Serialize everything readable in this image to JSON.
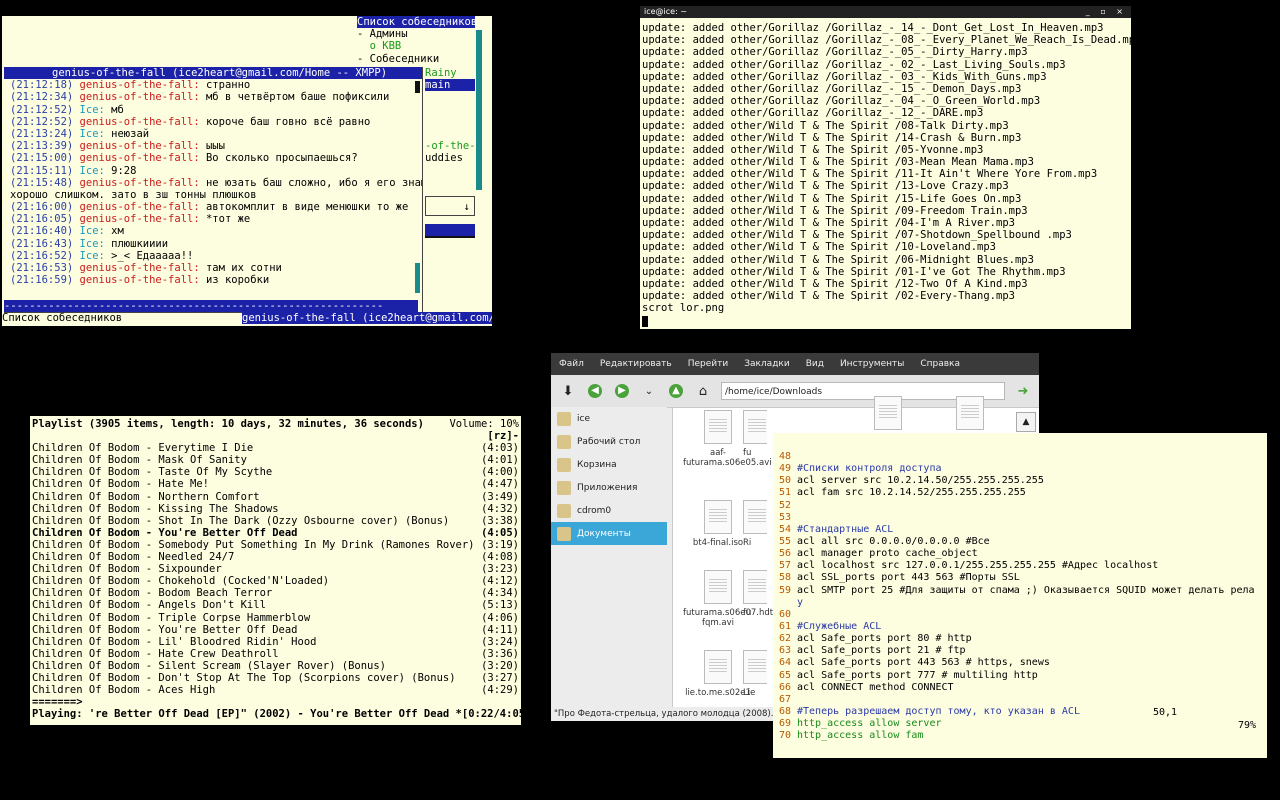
{
  "chat": {
    "roster_title": "Список собеседников",
    "roster_items": [
      "- Админы",
      "  o KBB",
      "- Собеседники"
    ],
    "roster_fragments": {
      "rainy": "Rainy",
      "main": "main",
      "of_the": "-of-the-",
      "buddies": "uddies",
      "arrow": "↓"
    },
    "window_title": "genius-of-the-fall (ice2heart@gmail.com/Home -- XMPP)",
    "messages": [
      {
        "t": "(21:12:18)",
        "n": "genius-of-the-fall:",
        "m": " странно",
        "who": "g"
      },
      {
        "t": "(21:12:34)",
        "n": "genius-of-the-fall:",
        "m": " мб в четвёртом баше пофиксили",
        "who": "g"
      },
      {
        "t": "(21:12:52)",
        "n": "Ice:",
        "m": " мб",
        "who": "i"
      },
      {
        "t": "(21:12:52)",
        "n": "genius-of-the-fall:",
        "m": " короче баш говно всё равно",
        "who": "g"
      },
      {
        "t": "(21:13:24)",
        "n": "Ice:",
        "m": " неюзай",
        "who": "i"
      },
      {
        "t": "(21:13:39)",
        "n": "genius-of-the-fall:",
        "m": " ыыы",
        "who": "g"
      },
      {
        "t": "(21:15:00)",
        "n": "genius-of-the-fall:",
        "m": " Во сколько просыпаешься?",
        "who": "g"
      },
      {
        "t": "(21:15:11)",
        "n": "Ice:",
        "m": " 9:28",
        "who": "i"
      },
      {
        "t": "(21:15:48)",
        "n": "genius-of-the-fall:",
        "m": " не юзать баш сложно, ибо я его знаю",
        "who": "g"
      },
      {
        "t": "",
        "n": "",
        "m": "хорошо слишком. зато в зш тонны плюшков",
        "who": "c"
      },
      {
        "t": "(21:16:00)",
        "n": "genius-of-the-fall:",
        "m": " автокомплит в виде менюшки то же",
        "who": "g"
      },
      {
        "t": "(21:16:05)",
        "n": "genius-of-the-fall:",
        "m": " *тот же",
        "who": "g"
      },
      {
        "t": "(21:16:40)",
        "n": "Ice:",
        "m": " хм",
        "who": "i"
      },
      {
        "t": "(21:16:43)",
        "n": "Ice:",
        "m": " плюшкииии",
        "who": "i"
      },
      {
        "t": "(21:16:52)",
        "n": "Ice:",
        "m": " >_< Едааааа!!",
        "who": "i"
      },
      {
        "t": "(21:16:53)",
        "n": "genius-of-the-fall:",
        "m": " там их сотни",
        "who": "g"
      },
      {
        "t": "(21:16:59)",
        "n": "genius-of-the-fall:",
        "m": " из коробки",
        "who": "g"
      }
    ],
    "separator": "------------------------------------------------------------",
    "status_left": "Список собеседников",
    "status_right": "genius-of-the-fall (ice2heart@gmail.com/"
  },
  "log": {
    "title": "ice@ice: ~",
    "title_buttons": "_ ▫ ×",
    "lines": [
      "update: added other/Gorillaz /Gorillaz_-_14_-_Dont_Get_Lost_In_Heaven.mp3",
      "update: added other/Gorillaz /Gorillaz_-_08_-_Every_Planet_We_Reach_Is_Dead.mp3",
      "update: added other/Gorillaz /Gorillaz_-_05_-_Dirty_Harry.mp3",
      "update: added other/Gorillaz /Gorillaz_-_02_-_Last_Living_Souls.mp3",
      "update: added other/Gorillaz /Gorillaz_-_03_-_Kids_With_Guns.mp3",
      "update: added other/Gorillaz /Gorillaz_-_15_-_Demon_Days.mp3",
      "update: added other/Gorillaz /Gorillaz_-_04_-_O_Green_World.mp3",
      "update: added other/Gorillaz /Gorillaz_-_12_-_DARE.mp3",
      "update: added other/Wild T & The Spirit /08-Talk Dirty.mp3",
      "update: added other/Wild T & The Spirit /14-Crash & Burn.mp3",
      "update: added other/Wild T & The Spirit /05-Yvonne.mp3",
      "update: added other/Wild T & The Spirit /03-Mean Mean Mama.mp3",
      "update: added other/Wild T & The Spirit /11-It Ain't Where Yore From.mp3",
      "update: added other/Wild T & The Spirit /13-Love Crazy.mp3",
      "update: added other/Wild T & The Spirit /15-Life Goes On.mp3",
      "update: added other/Wild T & The Spirit /09-Freedom Train.mp3",
      "update: added other/Wild T & The Spirit /04-I'm A River.mp3",
      "update: added other/Wild T & The Spirit /07-Shotdown_Spellbound .mp3",
      "update: added other/Wild T & The Spirit /10-Loveland.mp3",
      "update: added other/Wild T & The Spirit /06-Midnight Blues.mp3",
      "update: added other/Wild T & The Spirit /01-I've Got The Rhythm.mp3",
      "update: added other/Wild T & The Spirit /12-Two Of A Kind.mp3",
      "update: added other/Wild T & The Spirit /02-Every-Thang.mp3",
      "scrot lor.png"
    ]
  },
  "playlist": {
    "header_left": "Playlist (3905 items, length: 10 days, 32 minutes, 36 seconds)",
    "header_right": "Volume: 10%",
    "mode": "[rz]-",
    "rows": [
      {
        "title": "Children Of Bodom - Everytime I Die",
        "len": "(4:03)"
      },
      {
        "title": "Children Of Bodom - Mask Of Sanity",
        "len": "(4:01)"
      },
      {
        "title": "Children Of Bodom - Taste Of My Scythe",
        "len": "(4:00)"
      },
      {
        "title": "Children Of Bodom - Hate Me!",
        "len": "(4:47)"
      },
      {
        "title": "Children Of Bodom - Northern Comfort",
        "len": "(3:49)"
      },
      {
        "title": "Children Of Bodom - Kissing The Shadows",
        "len": "(4:32)"
      },
      {
        "title": "Children Of Bodom - Shot In The Dark (Ozzy Osbourne cover) (Bonus)",
        "len": "(3:38)"
      },
      {
        "title": "Children Of Bodom - You're Better Off Dead",
        "len": "(4:05)",
        "current": true
      },
      {
        "title": "Children Of Bodom - Somebody Put Something In My Drink (Ramones Rover)",
        "len": "(3:19)"
      },
      {
        "title": "Children Of Bodom - Needled 24/7",
        "len": "(4:08)"
      },
      {
        "title": "Children Of Bodom - Sixpounder",
        "len": "(3:23)"
      },
      {
        "title": "Children Of Bodom - Chokehold (Cocked'N'Loaded)",
        "len": "(4:12)"
      },
      {
        "title": "Children Of Bodom - Bodom Beach Terror",
        "len": "(4:34)"
      },
      {
        "title": "Children Of Bodom - Angels Don't Kill",
        "len": "(5:13)"
      },
      {
        "title": "Children Of Bodom - Triple Corpse Hammerblow",
        "len": "(4:06)"
      },
      {
        "title": "Children Of Bodom - You're Better Off Dead",
        "len": "(4:11)"
      },
      {
        "title": "Children Of Bodom - Lil' Bloodred Ridin' Hood",
        "len": "(3:24)"
      },
      {
        "title": "Children Of Bodom - Hate Crew Deathroll",
        "len": "(3:36)"
      },
      {
        "title": "Children Of Bodom - Silent Scream (Slayer Rover) (Bonus)",
        "len": "(3:20)"
      },
      {
        "title": "Children Of Bodom - Don't Stop At The Top (Scorpions cover) (Bonus)",
        "len": "(3:27)"
      },
      {
        "title": "Children Of Bodom - Aces High",
        "len": "(4:29)"
      }
    ],
    "progress": "=======>",
    "playing": "Playing: 're Better Off Dead [EP]\" (2002) - You're Better Off Dead *",
    "playing_time": "[0:22/4:05]"
  },
  "fm": {
    "menu": [
      "Файл",
      "Редактировать",
      "Перейти",
      "Закладки",
      "Вид",
      "Инструменты",
      "Справка"
    ],
    "path": "/home/ice/Downloads",
    "sidebar": [
      "ice",
      "Рабочий стол",
      "Корзина",
      "Приложения",
      "cdrom0",
      "Документы"
    ],
    "files": [
      {
        "name": "aaf-futurama.s06e05.avi"
      },
      {
        "name": "fu"
      },
      {
        "name": "bt4-final.iso"
      },
      {
        "name": "Ri"
      },
      {
        "name": "futurama.s06e07.hdtv.xvid-fqm.avi"
      },
      {
        "name": "fu"
      },
      {
        "name": "lie.to.me.s02e1"
      },
      {
        "name": "Lie"
      }
    ],
    "status": "\"Про Федота-стрельца, удалого молодца (2008).avi"
  },
  "vim": {
    "lines": [
      {
        "n": "48",
        "code": ""
      },
      {
        "n": "49",
        "code": "#Списки контроля доступа",
        "type": "c"
      },
      {
        "n": "50",
        "code": "acl server src 10.2.14.50/255.255.255.255",
        "type": "a"
      },
      {
        "n": "51",
        "code": "acl fam src 10.2.14.52/255.255.255.255",
        "type": "a"
      },
      {
        "n": "52",
        "code": ""
      },
      {
        "n": "53",
        "code": ""
      },
      {
        "n": "54",
        "code": "#Стандартные ACL",
        "type": "c"
      },
      {
        "n": "55",
        "code": "acl all src 0.0.0.0/0.0.0.0 #Все",
        "type": "a"
      },
      {
        "n": "56",
        "code": "acl manager proto cache_object",
        "type": "a"
      },
      {
        "n": "57",
        "code": "acl localhost src 127.0.0.1/255.255.255.255 #Адрес localhost",
        "type": "a"
      },
      {
        "n": "58",
        "code": "acl SSL_ports port 443 563 #Порты SSL",
        "type": "a"
      },
      {
        "n": "59",
        "code": "acl SMTP port 25 #Для защиты от спама ;) Оказывается SQUID может делать рела",
        "type": "a"
      },
      {
        "n": "",
        "code": "у",
        "type": "c"
      },
      {
        "n": "60",
        "code": ""
      },
      {
        "n": "61",
        "code": "#Служебные ACL",
        "type": "c"
      },
      {
        "n": "62",
        "code": "acl Safe_ports port 80 # http",
        "type": "a"
      },
      {
        "n": "63",
        "code": "acl Safe_ports port 21 # ftp",
        "type": "a"
      },
      {
        "n": "64",
        "code": "acl Safe_ports port 443 563 # https, snews",
        "type": "a"
      },
      {
        "n": "65",
        "code": "acl Safe_ports port 777 # multiling http",
        "type": "a"
      },
      {
        "n": "66",
        "code": "acl CONNECT method CONNECT",
        "type": "a"
      },
      {
        "n": "67",
        "code": ""
      },
      {
        "n": "68",
        "code": "#Теперь разрешаем доступ тому, кто указан в ACL",
        "type": "c"
      },
      {
        "n": "69",
        "code": "http_access allow server",
        "type": "h"
      },
      {
        "n": "70",
        "code": "http_access allow fam",
        "type": "h"
      }
    ],
    "status_pos": "50,1",
    "status_pct": "79%"
  }
}
